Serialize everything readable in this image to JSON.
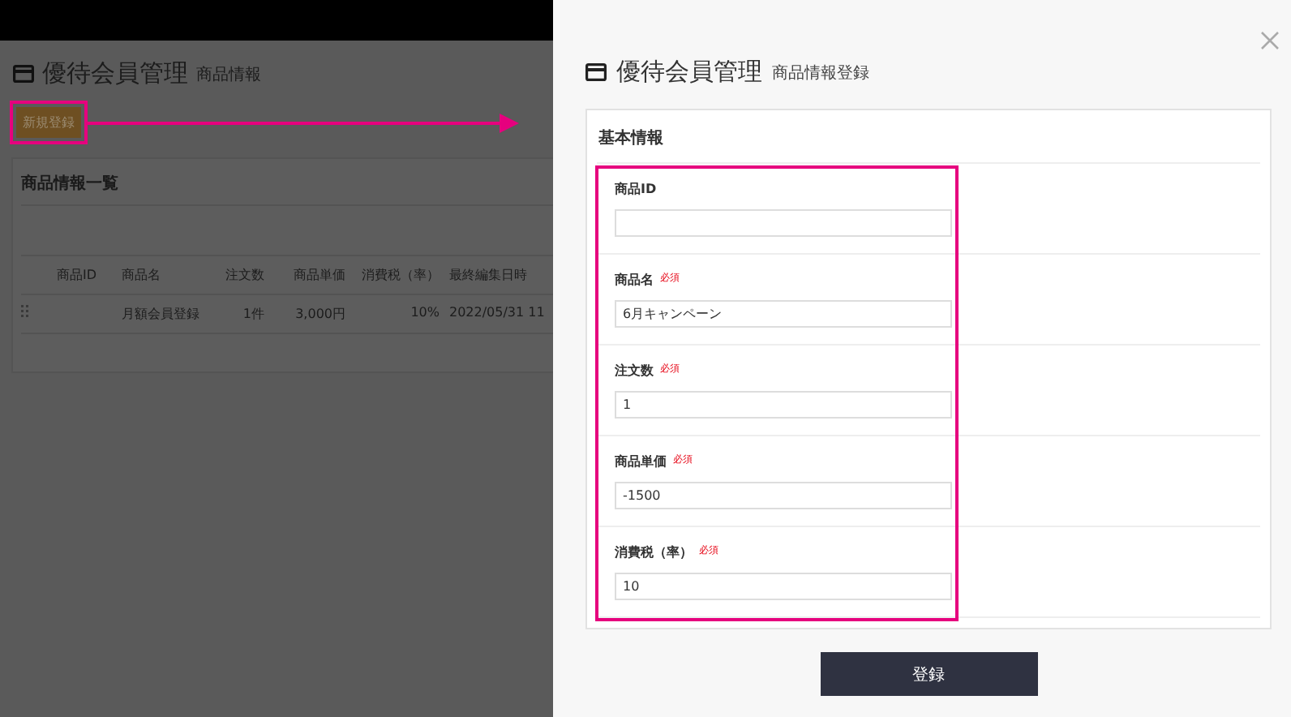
{
  "background_page": {
    "title": "優待会員管理",
    "subtitle": "商品情報",
    "new_button": "新規登録",
    "list_card": {
      "title": "商品情報一覧",
      "columns": [
        "商品ID",
        "商品名",
        "注文数",
        "商品単価",
        "消費税（率）",
        "最終編集日時"
      ],
      "rows": [
        {
          "cells": [
            null,
            "月額会員登録",
            "1件",
            "3,000円",
            "10%",
            "2022/05/31 11"
          ]
        }
      ]
    }
  },
  "drawer": {
    "title": "優待会員管理",
    "subtitle": "商品情報登録",
    "section_title": "基本情報",
    "fields": [
      {
        "label": "商品ID"
      },
      {
        "label": "商品名",
        "badge": "必須",
        "value": "6月キャンペーン"
      },
      {
        "label": "注文数",
        "badge": "必須",
        "value": "1"
      },
      {
        "label": "商品単価",
        "badge": "必須",
        "value": "-1500"
      },
      {
        "label": "消費税（率）",
        "badge": "必須",
        "value": "10"
      }
    ],
    "submit_button": "登録"
  }
}
